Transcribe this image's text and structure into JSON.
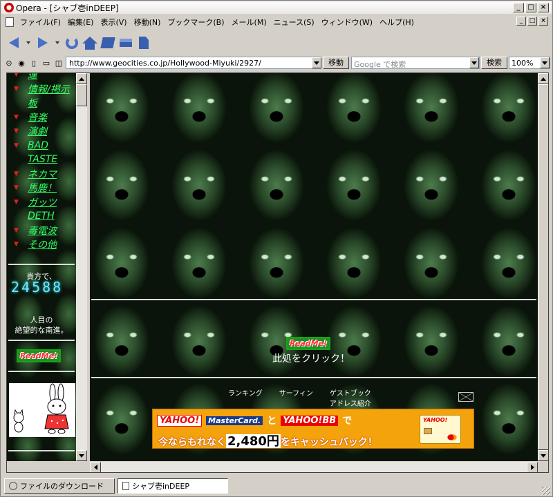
{
  "window": {
    "title": "Opera - [シャブ壱inDEEP]",
    "buttons": {
      "minimize": "_",
      "maximize": "□",
      "close": "×"
    }
  },
  "menu": [
    "ファイル(F)",
    "編集(E)",
    "表示(V)",
    "移動(N)",
    "ブックマーク(B)",
    "メール(M)",
    "ニュース(S)",
    "ウィンドウ(W)",
    "ヘルプ(H)"
  ],
  "address": {
    "url": "http://www.geocities.co.jp/Hollywood-Miyuki/2927/",
    "go_label": "移動",
    "search_placeholder": "Google で検索",
    "search_label": "検索",
    "zoom": "100%"
  },
  "left_frame": {
    "nav": [
      {
        "arrow": "▼",
        "label": "運"
      },
      {
        "arrow": "▼",
        "label": "情報/掲示"
      },
      {
        "arrow": "",
        "label": "板"
      },
      {
        "arrow": "▼",
        "label": "音楽"
      },
      {
        "arrow": "▼",
        "label": "演劇"
      },
      {
        "arrow": "▼",
        "label": "BAD"
      },
      {
        "arrow": "",
        "label": "TASTE"
      },
      {
        "arrow": "▼",
        "label": "ネカマ"
      },
      {
        "arrow": "▼",
        "label": "馬鹿！"
      },
      {
        "arrow": "▼",
        "label": "ガッツ"
      },
      {
        "arrow": "",
        "label": "DETH"
      },
      {
        "arrow": "▼",
        "label": "毒電波"
      },
      {
        "arrow": "▼",
        "label": "その他"
      }
    ],
    "counter_caption_top": "貴方で、",
    "counter_value": "24588",
    "counter_caption_bottom": [
      "人目の",
      "絶望的な南進。"
    ],
    "readme_button": "ReadMe!"
  },
  "main_frame": {
    "readme_button": "ReadMe!",
    "click_text": "此処をクリック！",
    "footer_links": [
      {
        "lines": [
          "ランキング"
        ]
      },
      {
        "lines": [
          "サーフィン"
        ]
      },
      {
        "lines": [
          "ゲストブック",
          "アドレス紹介"
        ]
      }
    ],
    "mail_icon": "envelope-icon",
    "banner": {
      "yahoo": "YAHOO!",
      "mastercard": "MasterCard.",
      "and": "と",
      "yahoo_bb": "YAHOO!BB",
      "de": "で",
      "line2_pre": "今ならもれなく",
      "amount": "2,480円",
      "line2_post": "をキャッシュバック！",
      "card_label": "YAHOO!"
    }
  },
  "statusbar": {
    "tabs": [
      {
        "label": "ファイルのダウンロード",
        "active": false
      },
      {
        "label": "シャブ壱inDEEP",
        "active": true
      }
    ]
  },
  "colors": {
    "link": "#33ff66",
    "arrow": "#e0201e",
    "counter": "#88ddff",
    "banner": "#f4a30c"
  }
}
